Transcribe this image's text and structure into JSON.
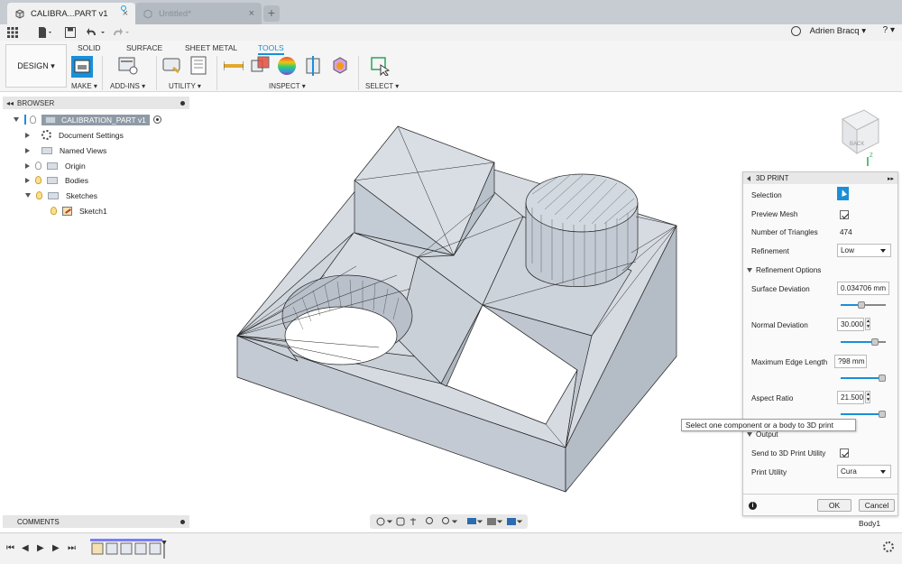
{
  "tabs": [
    {
      "label": "CALIBRA...PART v1",
      "active": true
    },
    {
      "label": "Untitled*",
      "active": false
    }
  ],
  "user": {
    "name": "Adrien Bracq ▾"
  },
  "help_label": "? ▾",
  "workspace": {
    "label": "DESIGN ▾"
  },
  "ribbon_tabs": [
    "SOLID",
    "SURFACE",
    "SHEET METAL",
    "TOOLS"
  ],
  "ribbon_active_tab": "TOOLS",
  "ribbon_groups": {
    "make": "MAKE ▾",
    "addins": "ADD-INS ▾",
    "utility": "UTILITY ▾",
    "inspect": "INSPECT ▾",
    "select": "SELECT ▾"
  },
  "browser": {
    "title": "BROWSER",
    "root": "CALIBRATION_PART v1",
    "items": [
      {
        "label": "Document Settings",
        "icon": "gear-icon"
      },
      {
        "label": "Named Views",
        "icon": "folder-icon"
      },
      {
        "label": "Origin",
        "icon": "folder-icon"
      },
      {
        "label": "Bodies",
        "icon": "folder-icon"
      },
      {
        "label": "Sketches",
        "icon": "folder-icon"
      },
      {
        "label": "Sketch1",
        "icon": "sketch-icon"
      }
    ]
  },
  "viewcube": {
    "label": "BACK",
    "axis_z": "Z"
  },
  "print_panel": {
    "title": "3D PRINT",
    "selection_label": "Selection",
    "preview_mesh_label": "Preview Mesh",
    "triangles_label": "Number of Triangles",
    "triangles_value": "474",
    "refinement_label": "Refinement",
    "refinement_value": "Low",
    "refinement_options_label": "Refinement Options",
    "surface_dev_label": "Surface Deviation",
    "surface_dev_value": "0.034706 mm",
    "surface_dev_slider": 0.45,
    "normal_dev_label": "Normal Deviation",
    "normal_dev_value": "30.000",
    "normal_dev_slider": 0.8,
    "max_edge_label": "Maximum Edge Length",
    "max_edge_value": "?98 mm",
    "max_edge_slider": 1.0,
    "aspect_label": "Aspect Ratio",
    "aspect_value": "21.500",
    "aspect_slider": 1.0,
    "output_label": "Output",
    "send_label": "Send to 3D Print Utility",
    "utility_label": "Print Utility",
    "utility_value": "Cura",
    "ok": "OK",
    "cancel": "Cancel"
  },
  "tooltip": "Select one component or a body to 3D print",
  "comments": {
    "title": "COMMENTS"
  },
  "status_body": "Body1",
  "colors": {
    "accent": "#1a8fd8",
    "part_face": "#c9d0d9"
  }
}
